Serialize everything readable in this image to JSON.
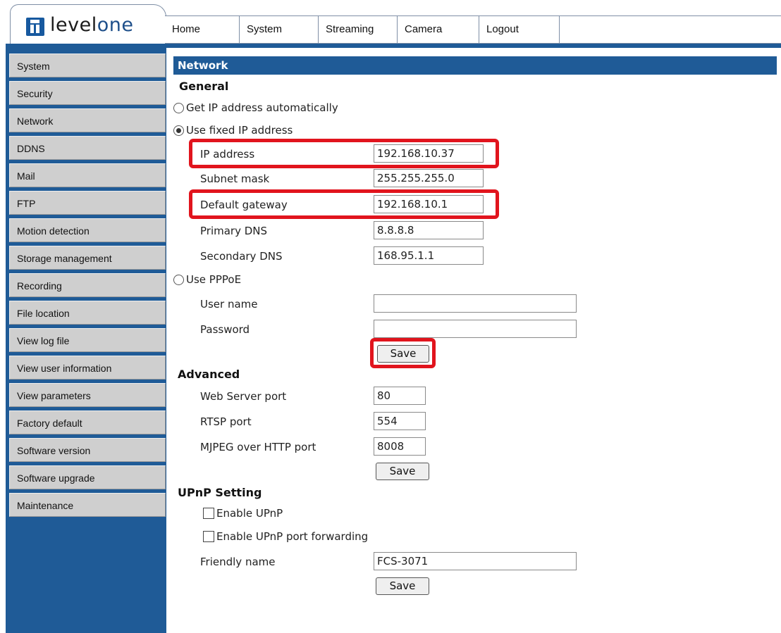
{
  "brand": {
    "name_bold": "level",
    "name_light": "one"
  },
  "tabs": [
    {
      "label": "Home"
    },
    {
      "label": "System",
      "active": true
    },
    {
      "label": "Streaming"
    },
    {
      "label": "Camera"
    },
    {
      "label": "Logout"
    }
  ],
  "sidebar": {
    "items": [
      {
        "label": "System"
      },
      {
        "label": "Security"
      },
      {
        "label": "Network",
        "active": true
      },
      {
        "label": "DDNS"
      },
      {
        "label": "Mail"
      },
      {
        "label": "FTP"
      },
      {
        "label": "Motion detection"
      },
      {
        "label": "Storage management"
      },
      {
        "label": "Recording"
      },
      {
        "label": "File location"
      },
      {
        "label": "View log file"
      },
      {
        "label": "View user information"
      },
      {
        "label": "View parameters"
      },
      {
        "label": "Factory default"
      },
      {
        "label": "Software version"
      },
      {
        "label": "Software upgrade"
      },
      {
        "label": "Maintenance"
      }
    ]
  },
  "page": {
    "title": "Network"
  },
  "general": {
    "heading": "General",
    "radio_auto": "Get IP address automatically",
    "radio_fixed": "Use fixed IP address",
    "selected_mode": "fixed",
    "ip_label": "IP address",
    "ip_value": "192.168.10.37",
    "subnet_label": "Subnet mask",
    "subnet_value": "255.255.255.0",
    "gateway_label": "Default gateway",
    "gateway_value": "192.168.10.1",
    "dns1_label": "Primary DNS",
    "dns1_value": "8.8.8.8",
    "dns2_label": "Secondary DNS",
    "dns2_value": "168.95.1.1",
    "radio_pppoe": "Use PPPoE",
    "user_label": "User name",
    "user_value": "",
    "password_label": "Password",
    "password_value": "",
    "save_label": "Save"
  },
  "advanced": {
    "heading": "Advanced",
    "web_port_label": "Web Server port",
    "web_port_value": "80",
    "rtsp_label": "RTSP port",
    "rtsp_value": "554",
    "mjpeg_label": "MJPEG over HTTP port",
    "mjpeg_value": "8008",
    "save_label": "Save"
  },
  "upnp": {
    "heading": "UPnP Setting",
    "enable_label": "Enable UPnP",
    "enable_checked": false,
    "forward_label": "Enable UPnP port forwarding",
    "forward_checked": false,
    "friendly_label": "Friendly name",
    "friendly_value": "FCS-3071",
    "save_label": "Save"
  },
  "colors": {
    "frame_blue": "#1f5b97",
    "highlight_red": "#e1141d",
    "sidebar_button": "#cfcfcf"
  }
}
